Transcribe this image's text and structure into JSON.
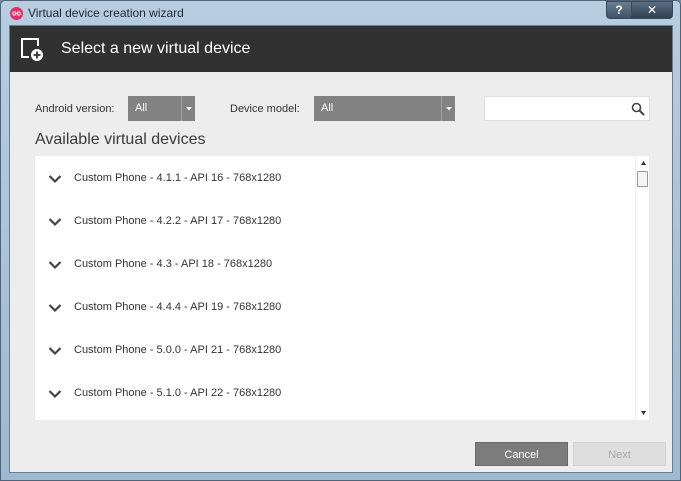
{
  "window": {
    "title": "Virtual device creation wizard",
    "help_label": "?",
    "close_label": "✕"
  },
  "header": {
    "title": "Select a new virtual device",
    "icon": "add-device-icon"
  },
  "filters": {
    "android_version_label": "Android version:",
    "android_version_value": "All",
    "device_model_label": "Device model:",
    "device_model_value": "All",
    "search_value": "",
    "search_icon": "search-icon"
  },
  "section_title": "Available virtual devices",
  "devices": [
    {
      "label": "Custom Phone - 4.1.1 - API 16 - 768x1280"
    },
    {
      "label": "Custom Phone - 4.2.2 - API 17 - 768x1280"
    },
    {
      "label": "Custom Phone - 4.3 - API 18 - 768x1280"
    },
    {
      "label": "Custom Phone - 4.4.4 - API 19 - 768x1280"
    },
    {
      "label": "Custom Phone - 5.0.0 - API 21 - 768x1280"
    },
    {
      "label": "Custom Phone - 5.1.0 - API 22 - 768x1280"
    }
  ],
  "buttons": {
    "cancel_label": "Cancel",
    "next_label": "Next",
    "next_enabled": false
  },
  "colors": {
    "header_bg": "#313131",
    "accent_pink": "#e0306a",
    "select_bg": "#828282",
    "cancel_bg": "#7c7c7c"
  }
}
